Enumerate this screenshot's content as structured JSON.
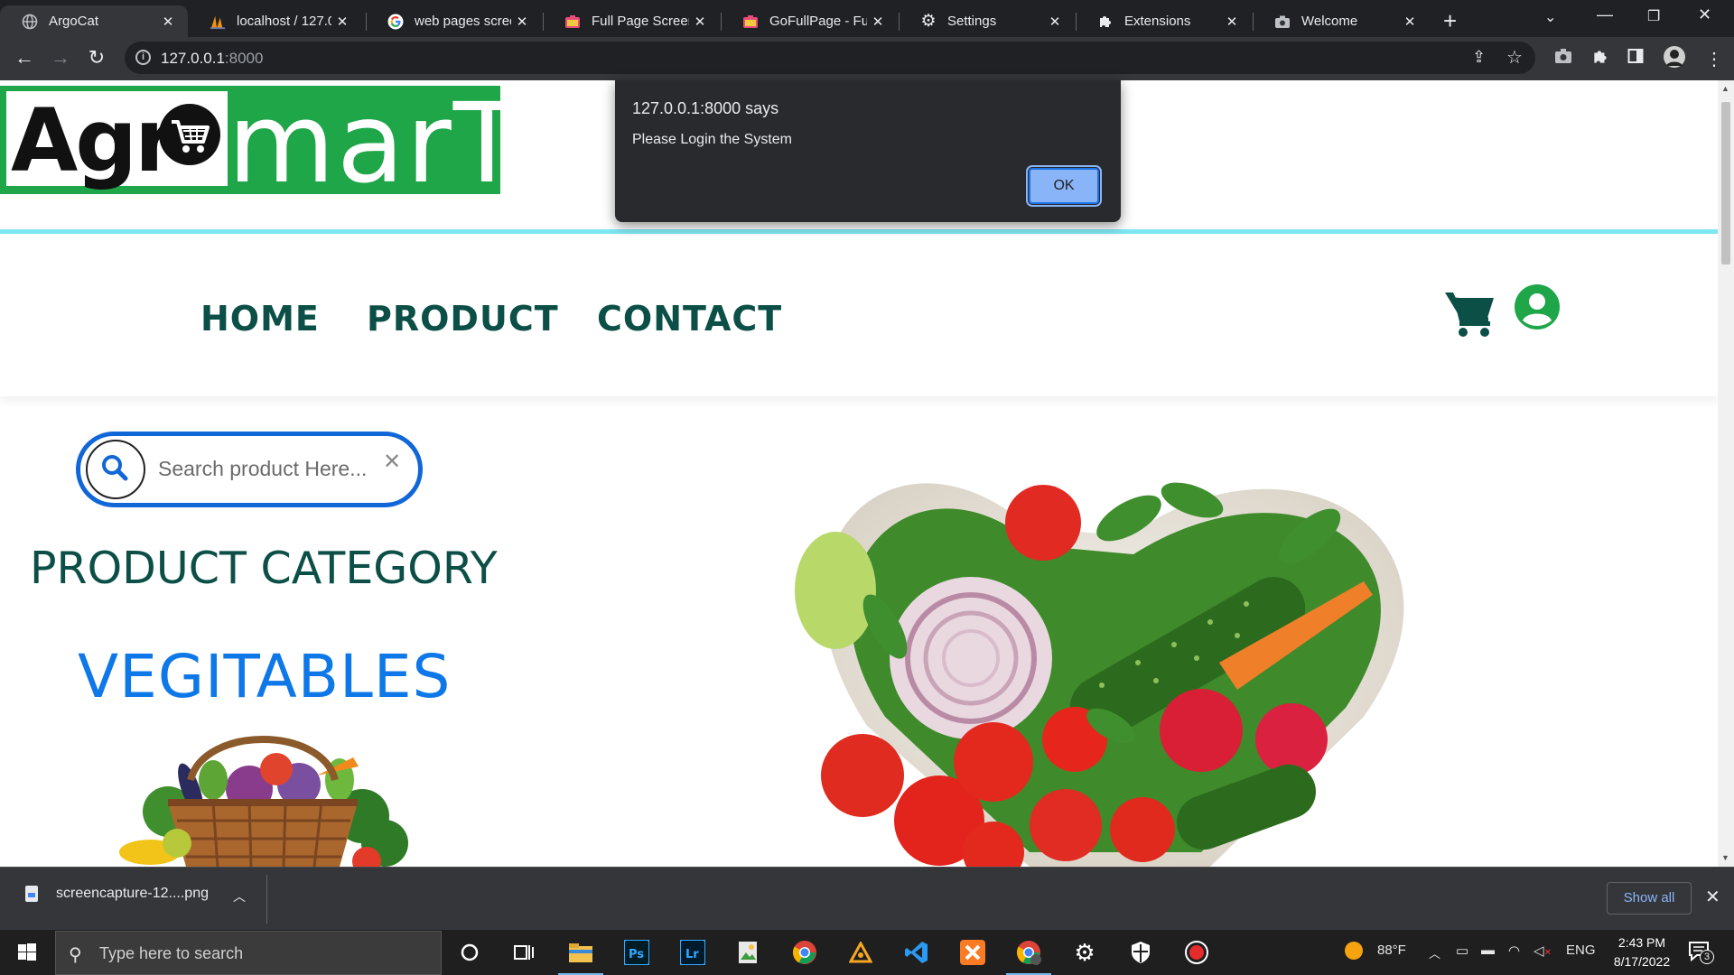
{
  "browser": {
    "tabs": [
      {
        "title": "ArgoCat",
        "active": true
      },
      {
        "title": "localhost / 127.0.0",
        "active": false
      },
      {
        "title": "web pages screen",
        "active": false
      },
      {
        "title": "Full Page Screens",
        "active": false
      },
      {
        "title": "GoFullPage - Full",
        "active": false
      },
      {
        "title": "Settings",
        "active": false
      },
      {
        "title": "Extensions",
        "active": false
      },
      {
        "title": "Welcome",
        "active": false
      }
    ],
    "url_host": "127.0.0.1",
    "url_port": ":8000"
  },
  "dialog": {
    "origin": "127.0.0.1:8000 says",
    "message": "Please Login the System",
    "ok_label": "OK"
  },
  "site": {
    "logo_left": "Agr",
    "logo_right": "marT",
    "nav": [
      "HOME",
      "PRODUCT",
      "CONTACT"
    ],
    "search_placeholder": "Search product Here....",
    "category_heading": "PRODUCT CATEGORY",
    "category_item": "VEGITABLES"
  },
  "downloads": {
    "file": "screencapture-12....png",
    "show_all": "Show all"
  },
  "taskbar": {
    "search_placeholder": "Type here to search",
    "weather": "88°F",
    "language": "ENG",
    "time": "2:43 PM",
    "date": "8/17/2022",
    "notifications": "3"
  },
  "colors": {
    "brand_green": "#1ea649",
    "nav_dark_green": "#0b4f46",
    "link_blue": "#0f78e8",
    "search_border": "#1166d8",
    "cyan_rule": "#7fe7f2"
  }
}
